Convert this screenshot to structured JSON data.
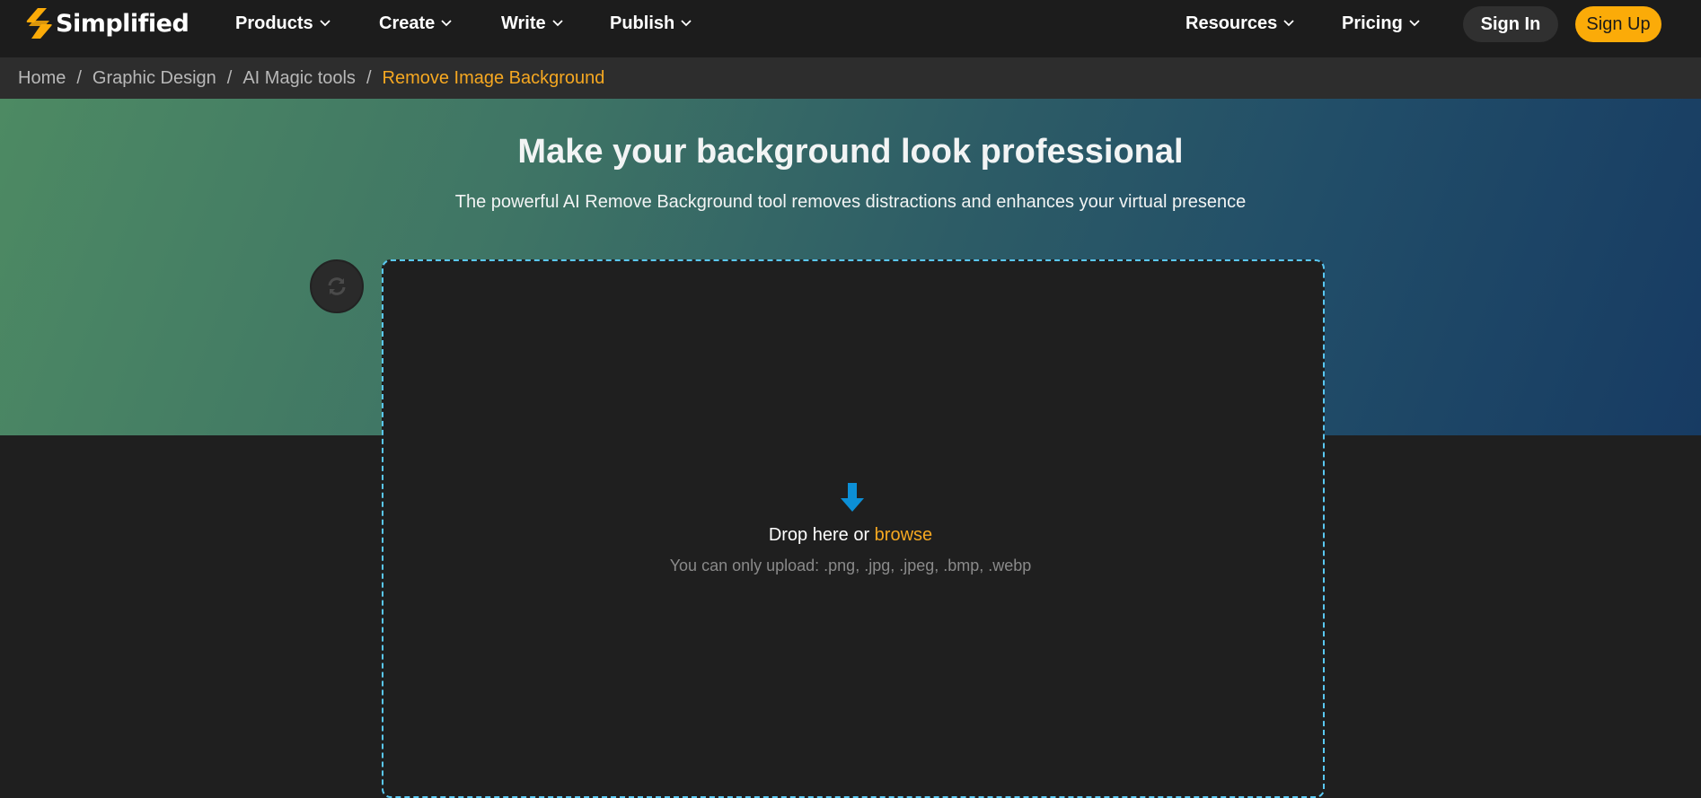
{
  "brand": {
    "name": "Simplified",
    "accent": "#fbab08"
  },
  "nav": {
    "items": [
      {
        "label": "Products"
      },
      {
        "label": "Create"
      },
      {
        "label": "Write"
      },
      {
        "label": "Publish"
      },
      {
        "label": "Resources"
      },
      {
        "label": "Pricing"
      }
    ],
    "sign_in": "Sign In",
    "sign_up": "Sign Up"
  },
  "breadcrumb": {
    "items": [
      "Home",
      "Graphic Design",
      "AI Magic tools"
    ],
    "current": "Remove Image Background",
    "separator": "/"
  },
  "hero": {
    "title": "Make your background look professional",
    "subtitle": "The powerful AI Remove Background tool removes distractions and enhances your virtual presence"
  },
  "upload": {
    "drop_text": "Drop here or",
    "browse_text": "browse",
    "hint": "You can only upload: .png, .jpg, .jpeg, .bmp, .webp",
    "icon": "arrow-down-icon",
    "refresh_icon": "refresh-icon"
  }
}
